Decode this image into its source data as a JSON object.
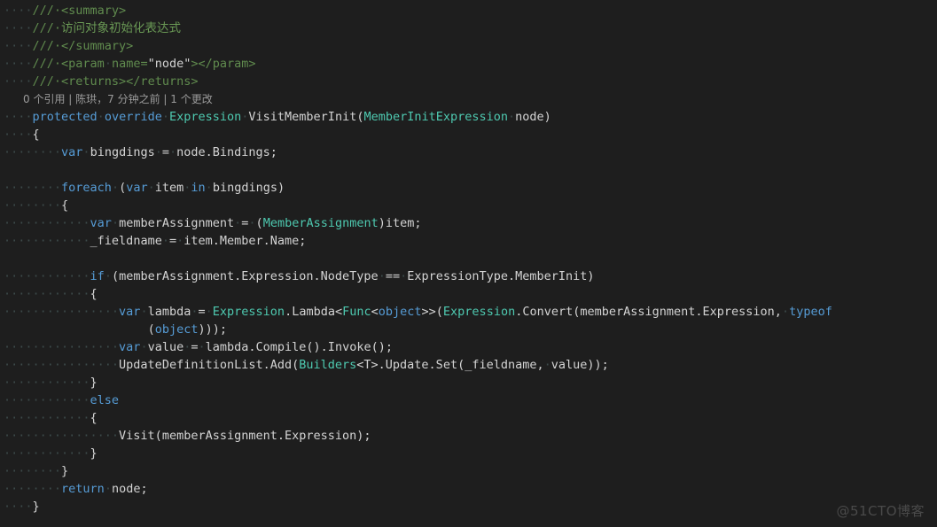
{
  "editor": {
    "theme": "vscode-dark-plus",
    "background_color": "#1e1e1e",
    "language": "csharp",
    "colors": {
      "keyword": "#569cd6",
      "type": "#4ec9b0",
      "comment": "#608b4e",
      "plain_text": "#d4d4d4",
      "whitespace_dot": "#3c4a4a",
      "codelens": "#9b9b9b",
      "watermark": "#4a4a4a"
    }
  },
  "codelens": {
    "text": "0 个引用 | 陈珙，7 分钟之前 | 1 个更改",
    "references_count": "0 个引用",
    "author": "陈珙",
    "modified_time": "7 分钟之前",
    "changes_count": "1 个更改"
  },
  "watermark": {
    "text": "@51CTO博客"
  },
  "code_lines": [
    {
      "index": 1,
      "text": "    /// <summary>",
      "tokens": [
        {
          "t": "····",
          "c": "ws"
        },
        {
          "t": "///·",
          "c": "cmt"
        },
        {
          "t": "<summary>",
          "c": "cmt"
        }
      ]
    },
    {
      "index": 2,
      "text": "    /// 访问对象初始化表达式",
      "tokens": [
        {
          "t": "····",
          "c": "ws"
        },
        {
          "t": "///·",
          "c": "cmt"
        },
        {
          "t": "访问对象初始化表达式",
          "c": "cmtcn"
        }
      ]
    },
    {
      "index": 3,
      "text": "    /// </summary>",
      "tokens": [
        {
          "t": "····",
          "c": "ws"
        },
        {
          "t": "///·",
          "c": "cmt"
        },
        {
          "t": "</summary>",
          "c": "cmt"
        }
      ]
    },
    {
      "index": 4,
      "text": "    /// <param name=\"node\"></param>",
      "tokens": [
        {
          "t": "····",
          "c": "ws"
        },
        {
          "t": "///·",
          "c": "cmt"
        },
        {
          "t": "<param",
          "c": "cmt"
        },
        {
          "t": "·",
          "c": "ws"
        },
        {
          "t": "name=",
          "c": "cmt"
        },
        {
          "t": "\"node\"",
          "c": "plain"
        },
        {
          "t": "></param>",
          "c": "cmt"
        }
      ]
    },
    {
      "index": 5,
      "text": "    /// <returns></returns>",
      "tokens": [
        {
          "t": "····",
          "c": "ws"
        },
        {
          "t": "///·",
          "c": "cmt"
        },
        {
          "t": "<returns></returns>",
          "c": "cmt"
        }
      ]
    },
    {
      "index": 6,
      "is_codelens": true,
      "text": "0 个引用 | 陈珙，7 分钟之前 | 1 个更改"
    },
    {
      "index": 7,
      "text": "    protected override Expression VisitMemberInit(MemberInitExpression node)",
      "tokens": [
        {
          "t": "····",
          "c": "ws"
        },
        {
          "t": "protected",
          "c": "kw"
        },
        {
          "t": "·",
          "c": "ws"
        },
        {
          "t": "override",
          "c": "kw"
        },
        {
          "t": "·",
          "c": "ws"
        },
        {
          "t": "Expression",
          "c": "type"
        },
        {
          "t": "·",
          "c": "ws"
        },
        {
          "t": "VisitMemberInit(",
          "c": "plain"
        },
        {
          "t": "MemberInitExpression",
          "c": "type"
        },
        {
          "t": "·",
          "c": "ws"
        },
        {
          "t": "node)",
          "c": "plain"
        }
      ]
    },
    {
      "index": 8,
      "text": "    {",
      "tokens": [
        {
          "t": "····",
          "c": "ws"
        },
        {
          "t": "{",
          "c": "plain"
        }
      ]
    },
    {
      "index": 9,
      "text": "        var bingdings = node.Bindings;",
      "tokens": [
        {
          "t": "········",
          "c": "ws"
        },
        {
          "t": "var",
          "c": "kw"
        },
        {
          "t": "·",
          "c": "ws"
        },
        {
          "t": "bingdings",
          "c": "plain"
        },
        {
          "t": "·",
          "c": "ws"
        },
        {
          "t": "=",
          "c": "plain"
        },
        {
          "t": "·",
          "c": "ws"
        },
        {
          "t": "node.Bindings;",
          "c": "plain"
        }
      ]
    },
    {
      "index": 10,
      "text": "",
      "tokens": []
    },
    {
      "index": 11,
      "text": "        foreach (var item in bingdings)",
      "tokens": [
        {
          "t": "········",
          "c": "ws"
        },
        {
          "t": "foreach",
          "c": "kw"
        },
        {
          "t": "·",
          "c": "ws"
        },
        {
          "t": "(",
          "c": "plain"
        },
        {
          "t": "var",
          "c": "kw"
        },
        {
          "t": "·",
          "c": "ws"
        },
        {
          "t": "item",
          "c": "plain"
        },
        {
          "t": "·",
          "c": "ws"
        },
        {
          "t": "in",
          "c": "kw"
        },
        {
          "t": "·",
          "c": "ws"
        },
        {
          "t": "bingdings)",
          "c": "plain"
        }
      ]
    },
    {
      "index": 12,
      "text": "        {",
      "tokens": [
        {
          "t": "········",
          "c": "ws"
        },
        {
          "t": "{",
          "c": "plain"
        }
      ]
    },
    {
      "index": 13,
      "text": "            var memberAssignment = (MemberAssignment)item;",
      "tokens": [
        {
          "t": "············",
          "c": "ws"
        },
        {
          "t": "var",
          "c": "kw"
        },
        {
          "t": "·",
          "c": "ws"
        },
        {
          "t": "memberAssignment",
          "c": "plain"
        },
        {
          "t": "·",
          "c": "ws"
        },
        {
          "t": "=",
          "c": "plain"
        },
        {
          "t": "·",
          "c": "ws"
        },
        {
          "t": "(",
          "c": "plain"
        },
        {
          "t": "MemberAssignment",
          "c": "type"
        },
        {
          "t": ")item;",
          "c": "plain"
        }
      ]
    },
    {
      "index": 14,
      "text": "            _fieldname = item.Member.Name;",
      "tokens": [
        {
          "t": "············",
          "c": "ws"
        },
        {
          "t": "_fieldname",
          "c": "plain"
        },
        {
          "t": "·",
          "c": "ws"
        },
        {
          "t": "=",
          "c": "plain"
        },
        {
          "t": "·",
          "c": "ws"
        },
        {
          "t": "item.Member.Name;",
          "c": "plain"
        }
      ]
    },
    {
      "index": 15,
      "text": "",
      "tokens": []
    },
    {
      "index": 16,
      "text": "            if (memberAssignment.Expression.NodeType == ExpressionType.MemberInit)",
      "tokens": [
        {
          "t": "············",
          "c": "ws"
        },
        {
          "t": "if",
          "c": "kw"
        },
        {
          "t": "·",
          "c": "ws"
        },
        {
          "t": "(memberAssignment.Expression.NodeType",
          "c": "plain"
        },
        {
          "t": "·",
          "c": "ws"
        },
        {
          "t": "==",
          "c": "plain"
        },
        {
          "t": "·",
          "c": "ws"
        },
        {
          "t": "ExpressionType.MemberInit)",
          "c": "plain"
        }
      ]
    },
    {
      "index": 17,
      "text": "            {",
      "tokens": [
        {
          "t": "············",
          "c": "ws"
        },
        {
          "t": "{",
          "c": "plain"
        }
      ]
    },
    {
      "index": 18,
      "text": "                var lambda = Expression.Lambda<Func<object>>(Expression.Convert(memberAssignment.Expression, typeof",
      "tokens": [
        {
          "t": "················",
          "c": "ws"
        },
        {
          "t": "var",
          "c": "kw"
        },
        {
          "t": "·",
          "c": "ws"
        },
        {
          "t": "lambda",
          "c": "plain"
        },
        {
          "t": "·",
          "c": "ws"
        },
        {
          "t": "=",
          "c": "plain"
        },
        {
          "t": "·",
          "c": "ws"
        },
        {
          "t": "Expression",
          "c": "type"
        },
        {
          "t": ".Lambda<",
          "c": "plain"
        },
        {
          "t": "Func",
          "c": "type"
        },
        {
          "t": "<",
          "c": "plain"
        },
        {
          "t": "object",
          "c": "kw"
        },
        {
          "t": ">>(",
          "c": "plain"
        },
        {
          "t": "Expression",
          "c": "type"
        },
        {
          "t": ".Convert(memberAssignment.Expression,",
          "c": "plain"
        },
        {
          "t": "·",
          "c": "ws"
        },
        {
          "t": "typeof",
          "c": "kw"
        }
      ]
    },
    {
      "index": 19,
      "is_wrap": true,
      "text": "                    (object)));",
      "tokens": [
        {
          "t": "                    ",
          "c": "plain"
        },
        {
          "t": "(",
          "c": "plain"
        },
        {
          "t": "object",
          "c": "kw"
        },
        {
          "t": ")));",
          "c": "plain"
        }
      ]
    },
    {
      "index": 20,
      "text": "                var value = lambda.Compile().Invoke();",
      "tokens": [
        {
          "t": "················",
          "c": "ws"
        },
        {
          "t": "var",
          "c": "kw"
        },
        {
          "t": "·",
          "c": "ws"
        },
        {
          "t": "value",
          "c": "plain"
        },
        {
          "t": "·",
          "c": "ws"
        },
        {
          "t": "=",
          "c": "plain"
        },
        {
          "t": "·",
          "c": "ws"
        },
        {
          "t": "lambda.Compile().Invoke();",
          "c": "plain"
        }
      ]
    },
    {
      "index": 21,
      "text": "                UpdateDefinitionList.Add(Builders<T>.Update.Set(_fieldname, value));",
      "tokens": [
        {
          "t": "················",
          "c": "ws"
        },
        {
          "t": "UpdateDefinitionList.Add(",
          "c": "plain"
        },
        {
          "t": "Builders",
          "c": "type"
        },
        {
          "t": "<T>.Update.Set(_fieldname,",
          "c": "plain"
        },
        {
          "t": "·",
          "c": "ws"
        },
        {
          "t": "value));",
          "c": "plain"
        }
      ]
    },
    {
      "index": 22,
      "text": "            }",
      "tokens": [
        {
          "t": "············",
          "c": "ws"
        },
        {
          "t": "}",
          "c": "plain"
        }
      ]
    },
    {
      "index": 23,
      "text": "            else",
      "tokens": [
        {
          "t": "············",
          "c": "ws"
        },
        {
          "t": "else",
          "c": "kw"
        }
      ]
    },
    {
      "index": 24,
      "text": "            {",
      "tokens": [
        {
          "t": "············",
          "c": "ws"
        },
        {
          "t": "{",
          "c": "plain"
        }
      ]
    },
    {
      "index": 25,
      "text": "                Visit(memberAssignment.Expression);",
      "tokens": [
        {
          "t": "················",
          "c": "ws"
        },
        {
          "t": "Visit(memberAssignment.Expression);",
          "c": "plain"
        }
      ]
    },
    {
      "index": 26,
      "text": "            }",
      "tokens": [
        {
          "t": "············",
          "c": "ws"
        },
        {
          "t": "}",
          "c": "plain"
        }
      ]
    },
    {
      "index": 27,
      "text": "        }",
      "tokens": [
        {
          "t": "········",
          "c": "ws"
        },
        {
          "t": "}",
          "c": "plain"
        }
      ]
    },
    {
      "index": 28,
      "text": "        return node;",
      "tokens": [
        {
          "t": "········",
          "c": "ws"
        },
        {
          "t": "return",
          "c": "kw"
        },
        {
          "t": "·",
          "c": "ws"
        },
        {
          "t": "node;",
          "c": "plain"
        }
      ]
    },
    {
      "index": 29,
      "text": "    }",
      "tokens": [
        {
          "t": "····",
          "c": "ws"
        },
        {
          "t": "}",
          "c": "plain"
        }
      ]
    }
  ]
}
